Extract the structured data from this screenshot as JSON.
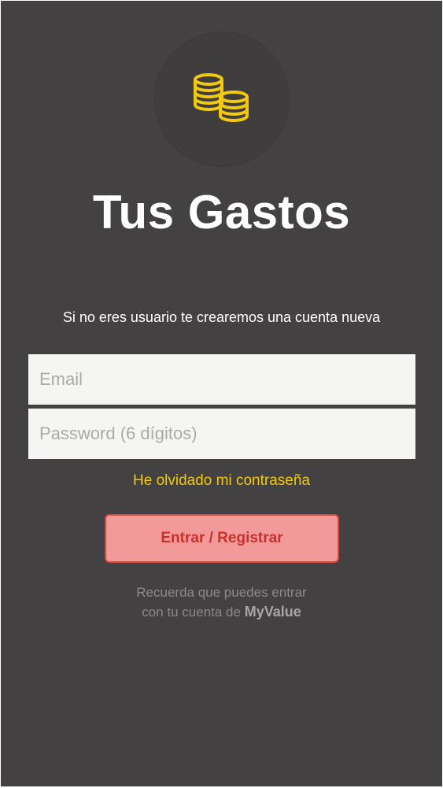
{
  "app": {
    "title": "Tus Gastos",
    "logo_icon": "coins-icon",
    "accent_color": "#f2c90f"
  },
  "intro": {
    "text": "Si no eres usuario te crearemos una cuenta nueva"
  },
  "form": {
    "email_placeholder": "Email",
    "email_value": "",
    "password_placeholder": "Password (6 dígitos)",
    "password_value": "",
    "forgot_label": "He olvidado mi contraseña",
    "submit_label": "Entrar / Registrar"
  },
  "footer": {
    "line1": "Recuerda que puedes entrar",
    "line2_prefix": "con tu cuenta de",
    "brand": "MyValue"
  }
}
